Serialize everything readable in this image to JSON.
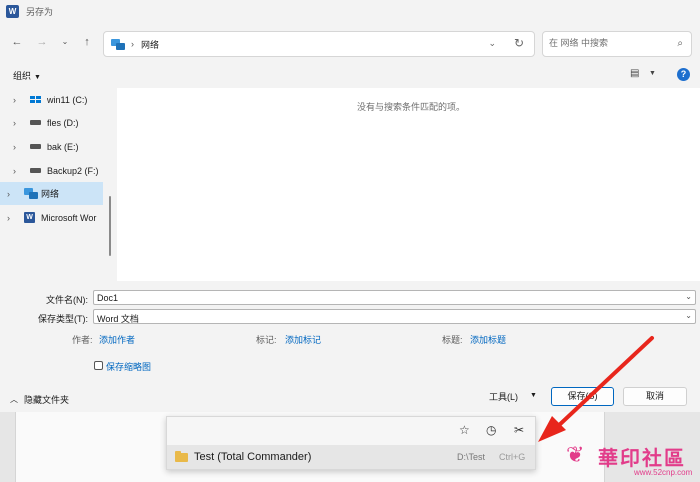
{
  "titlebar": {
    "app_icon": "W",
    "title": "另存为"
  },
  "nav": {
    "back_icon": "arrow-left-icon",
    "forward_icon": "arrow-right-icon",
    "recent_icon": "chevron-down-icon",
    "up_icon": "arrow-up-icon",
    "breadcrumb": "网络",
    "refresh_icon": "refresh-icon",
    "search_placeholder": "在 网络 中搜索"
  },
  "toolbar": {
    "organize_label": "组织",
    "help_label": "?"
  },
  "tree": {
    "items": [
      {
        "label": "win11 (C:)",
        "icon": "windows-drive-icon"
      },
      {
        "label": "fles (D:)",
        "icon": "drive-icon"
      },
      {
        "label": "bak (E:)",
        "icon": "drive-icon"
      },
      {
        "label": "Backup2 (F:)",
        "icon": "drive-icon"
      },
      {
        "label": "网络",
        "icon": "network-icon",
        "selected": true
      },
      {
        "label": "Microsoft Wor",
        "icon": "word-icon"
      }
    ]
  },
  "filelist": {
    "empty_message": "没有与搜索条件匹配的项。"
  },
  "form": {
    "filename_label": "文件名(N):",
    "filename_value": "Doc1",
    "filetype_label": "保存类型(T):",
    "filetype_value": "Word 文档",
    "authors_label": "作者:",
    "authors_link": "添加作者",
    "tags_label": "标记:",
    "tags_link": "添加标记",
    "title_label": "标题:",
    "title_link": "添加标题",
    "thumbnail_label": "保存缩略图"
  },
  "bottombar": {
    "hide_folders_label": "隐藏文件夹",
    "tools_label": "工具(L)",
    "save_label": "保存(S)",
    "cancel_label": "取消"
  },
  "popup": {
    "toolbar_icons": [
      "star-icon",
      "clock-icon",
      "tools-icon"
    ],
    "item_name": "Test (Total Commander)",
    "item_path": "D:\\Test",
    "item_shortcut": "Ctrl+G"
  },
  "annotation": {
    "arrow_color": "#e8261c"
  },
  "watermark": {
    "text": "華印社區",
    "url": "www.52cnp.com"
  }
}
